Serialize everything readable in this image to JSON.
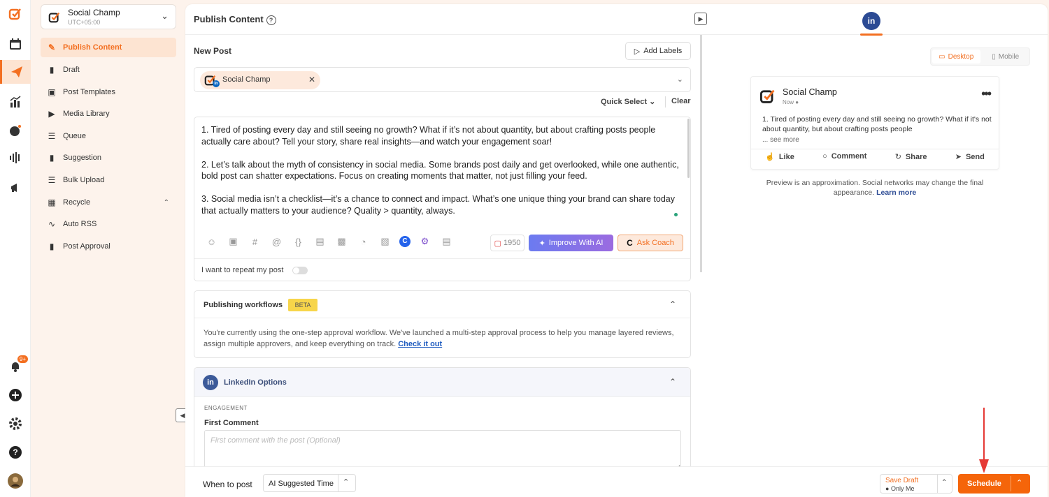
{
  "rail": {
    "notification_badge": "9+",
    "icons": [
      "social-champ-logo",
      "calendar-icon",
      "publish-icon",
      "analytics-icon",
      "engage-icon",
      "listening-icon",
      "megaphone-icon",
      "bell-icon",
      "plus-icon",
      "settings-icon",
      "help-icon",
      "avatar"
    ]
  },
  "account": {
    "name": "Social Champ",
    "timezone": "UTC+05:00"
  },
  "nav": {
    "items": [
      {
        "label": "Publish Content",
        "icon": "pencil-icon"
      },
      {
        "label": "Draft",
        "icon": "document-icon"
      },
      {
        "label": "Post Templates",
        "icon": "template-icon"
      },
      {
        "label": "Media Library",
        "icon": "media-icon"
      },
      {
        "label": "Queue",
        "icon": "queue-icon"
      },
      {
        "label": "Suggestion",
        "icon": "bookmark-icon"
      },
      {
        "label": "Bulk Upload",
        "icon": "layers-icon"
      },
      {
        "label": "Recycle",
        "icon": "archive-icon"
      },
      {
        "label": "Auto RSS",
        "icon": "rss-icon"
      },
      {
        "label": "Post Approval",
        "icon": "approval-icon"
      }
    ]
  },
  "header": {
    "title": "Publish Content",
    "help": "?"
  },
  "compose": {
    "title": "New Post",
    "add_labels": "Add Labels",
    "selected_account": "Social Champ",
    "quick_select": "Quick Select",
    "clear": "Clear",
    "paragraphs": [
      "1. Tired of posting every day and still seeing no growth? What if it’s not about quantity, but about crafting posts people actually care about? Tell your story, share real insights—and watch your engagement soar!",
      "2. Let’s talk about the myth of consistency in social media. Some brands post daily and get overlooked, while one authentic, bold post can shatter expectations. Focus on creating moments that matter, not just filling your feed.",
      "3. Social media isn’t a checklist—it’s a chance to connect and impact. What’s one unique thing your brand can share today that actually matters to your audience? Quality > quantity, always."
    ],
    "char_count": "1950",
    "improve_ai": "Improve With AI",
    "ask_coach": "Ask Coach",
    "repeat_label": "I want to repeat my post"
  },
  "workflow": {
    "title": "Publishing workflows",
    "badge": "BETA",
    "description": "You're currently using the one-step approval workflow. We've launched a multi-step approval process to help you manage layered reviews, assign multiple approvers, and keep everything on track.",
    "link": "Check it out"
  },
  "linkedin_options": {
    "title": "LinkedIn Options",
    "section": "ENGAGEMENT",
    "first_comment_label": "First Comment",
    "first_comment_placeholder": "First comment with the post (Optional)"
  },
  "footer": {
    "when_label": "When to post",
    "when_value": "AI Suggested Time",
    "save_draft": "Save Draft",
    "save_draft_scope": "Only Me",
    "schedule": "Schedule"
  },
  "preview": {
    "network": "in",
    "desktop": "Desktop",
    "mobile": "Mobile",
    "account_name": "Social Champ",
    "timestamp": "Now",
    "text": "1. Tired of posting every day and still seeing no growth? What if it's not about quantity, but about crafting posts people",
    "see_more": "... see more",
    "actions": [
      "Like",
      "Comment",
      "Share",
      "Send"
    ],
    "disclaimer": "Preview is an approximation. Social networks may change the final appearance.",
    "learn_more": "Learn more"
  },
  "colors": {
    "accent": "#f36f21",
    "linkedin": "#2c4b94",
    "improve_gradient_start": "#6b7bf0"
  }
}
